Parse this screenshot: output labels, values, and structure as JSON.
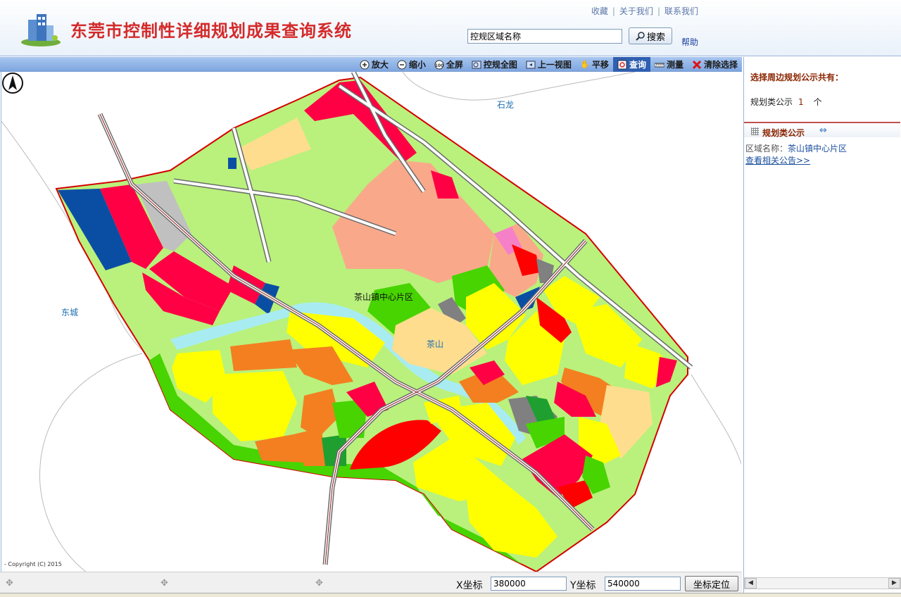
{
  "header": {
    "title": "东莞市控制性详细规划成果查询系统",
    "links": [
      "收藏",
      "关于我们",
      "联系我们"
    ],
    "search_value": "控规区域名称",
    "search_button": "搜索",
    "help": "帮助"
  },
  "toolbar": {
    "tools": [
      {
        "label": "放大",
        "icon": "zoom-in-icon"
      },
      {
        "label": "缩小",
        "icon": "zoom-out-icon"
      },
      {
        "label": "全屏",
        "icon": "fullscreen-icon"
      },
      {
        "label": "控规全图",
        "icon": "full-map-icon"
      },
      {
        "label": "上一视图",
        "icon": "previous-view-icon"
      },
      {
        "label": "平移",
        "icon": "pan-hand-icon"
      },
      {
        "label": "查询",
        "icon": "query-icon",
        "active": true
      },
      {
        "label": "测量",
        "icon": "ruler-icon"
      },
      {
        "label": "清除选择",
        "icon": "clear-selection-icon"
      }
    ]
  },
  "map": {
    "labels": {
      "shilong": "石龙",
      "dongcheng": "东城",
      "chashan": "茶山",
      "center_area": "茶山镇中心片区"
    },
    "copyright": "- Copyright (C) 2015"
  },
  "coords": {
    "x_label": "X坐标",
    "x_value": "380000",
    "y_label": "Y坐标",
    "y_value": "540000",
    "locate_button": "坐标定位"
  },
  "side": {
    "nearby_title": "选择周边规划公示共有：",
    "category_label": "规划类公示",
    "count": "1",
    "unit": "个",
    "section_title": "规划类公示",
    "area_label": "区域名称：",
    "area_value": "茶山镇中心片区",
    "notice_link": "查看相关公告>>"
  },
  "colors": {
    "title_red": "#d42a2a",
    "toolbar_blue": "#7ea6e0",
    "residential_yellow": "#ffff00",
    "commercial_red": "#ff0044",
    "green_space": "#b9f17c",
    "park_green": "#47d400",
    "salmon": "#f9a98a",
    "orange": "#f47f20",
    "blue": "#0a4ea4",
    "gray": "#c0c0c0",
    "water": "#a8ecf2"
  }
}
